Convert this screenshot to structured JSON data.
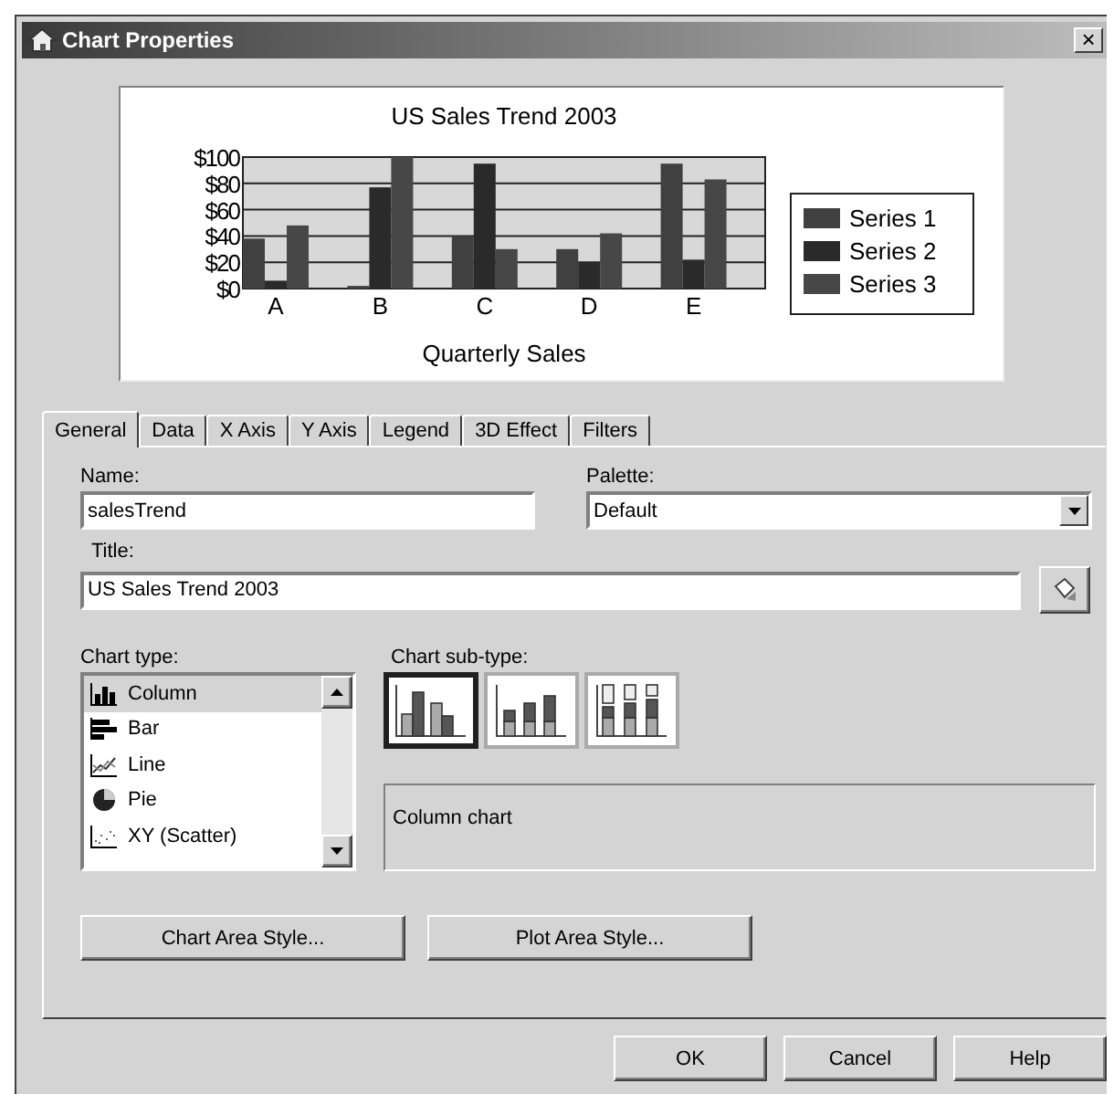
{
  "window": {
    "title": "Chart Properties",
    "close": "×"
  },
  "preview": {
    "chart_data": {
      "type": "bar",
      "grid": true,
      "legend": true,
      "title": "US Sales Trend 2003",
      "xlabel": "Quarterly Sales",
      "categories": [
        "A",
        "B",
        "C",
        "D",
        "E"
      ],
      "ylim": [
        0,
        100
      ],
      "yticks": [
        {
          "value": 0,
          "label": "$0"
        },
        {
          "value": 20,
          "label": "$20"
        },
        {
          "value": 40,
          "label": "$40"
        },
        {
          "value": 60,
          "label": "$60"
        },
        {
          "value": 80,
          "label": "$80"
        },
        {
          "value": 100,
          "label": "$100"
        }
      ],
      "series": [
        {
          "name": "Series 1",
          "color": "#404040",
          "values": [
            38,
            2,
            40,
            30,
            95
          ]
        },
        {
          "name": "Series 2",
          "color": "#2a2a2a",
          "values": [
            6,
            77,
            95,
            20,
            22
          ]
        },
        {
          "name": "Series 3",
          "color": "#474747",
          "values": [
            48,
            100,
            30,
            42,
            83
          ]
        }
      ]
    }
  },
  "tabs": [
    {
      "label": "General",
      "selected": true
    },
    {
      "label": "Data",
      "selected": false
    },
    {
      "label": "X Axis",
      "selected": false
    },
    {
      "label": "Y Axis",
      "selected": false
    },
    {
      "label": "Legend",
      "selected": false
    },
    {
      "label": "3D Effect",
      "selected": false
    },
    {
      "label": "Filters",
      "selected": false
    }
  ],
  "name_field": {
    "label": "Name:",
    "value": "salesTrend"
  },
  "palette_field": {
    "label": "Palette:",
    "value": "Default"
  },
  "title_field": {
    "label": "Title:",
    "value": "US Sales Trend 2003"
  },
  "chart_type": {
    "label": "Chart type:",
    "items": [
      {
        "kind": "column",
        "label": "Column",
        "selected": true
      },
      {
        "kind": "bar",
        "label": "Bar",
        "selected": false
      },
      {
        "kind": "line",
        "label": "Line",
        "selected": false
      },
      {
        "kind": "pie",
        "label": "Pie",
        "selected": false
      },
      {
        "kind": "scatter",
        "label": "XY (Scatter)",
        "selected": false
      }
    ]
  },
  "chart_subtype": {
    "label": "Chart sub-type:",
    "items": [
      {
        "kind": "clustered",
        "selected": true
      },
      {
        "kind": "stacked",
        "selected": false
      },
      {
        "kind": "percent",
        "selected": false
      }
    ],
    "description": "Column chart"
  },
  "style_buttons": [
    "Chart Area Style...",
    "Plot Area Style..."
  ],
  "buttons": [
    "OK",
    "Cancel",
    "Help"
  ]
}
